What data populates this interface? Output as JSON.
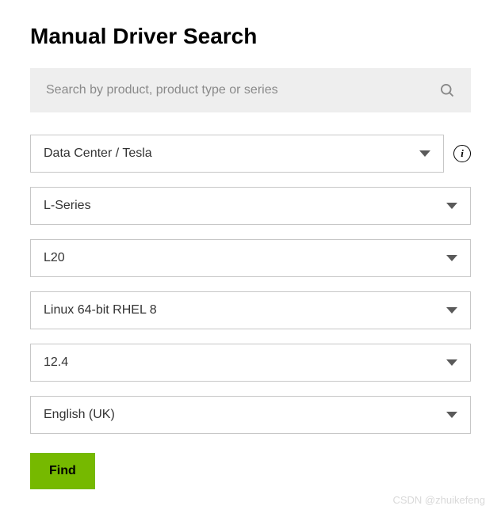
{
  "title": "Manual Driver Search",
  "search": {
    "placeholder": "Search by product, product type or series"
  },
  "selects": {
    "product_type": "Data Center / Tesla",
    "series": "L-Series",
    "product": "L20",
    "os": "Linux 64-bit RHEL 8",
    "cuda": "12.4",
    "language": "English (UK)"
  },
  "find_label": "Find",
  "watermark": "CSDN @zhuikefeng"
}
